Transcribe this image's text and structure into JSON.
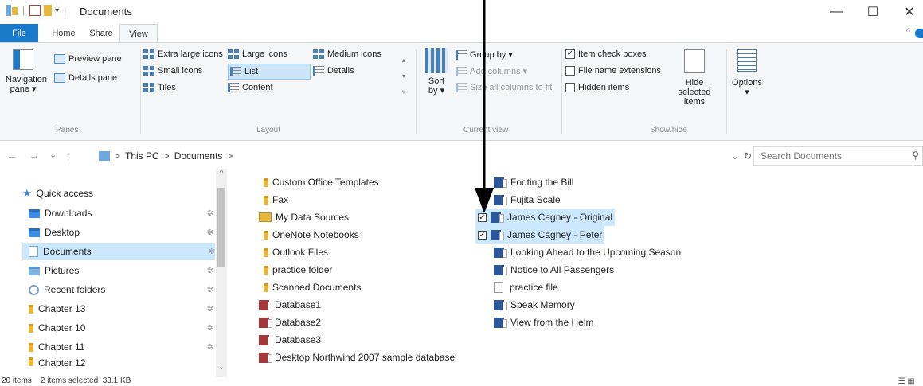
{
  "window": {
    "title": "Documents",
    "qat_dropdown": "▾",
    "minimize": "—",
    "maximize": "☐",
    "close": "✕"
  },
  "tabs": [
    {
      "label": "File"
    },
    {
      "label": "Home"
    },
    {
      "label": "Share"
    },
    {
      "label": "View"
    }
  ],
  "ribbon": {
    "panes": {
      "navigation_pane": "Navigation pane ▾",
      "preview_pane": "Preview pane",
      "details_pane": "Details pane",
      "group_label": "Panes"
    },
    "layout": {
      "extra_large_icons": "Extra large icons",
      "large_icons": "Large icons",
      "medium_icons": "Medium icons",
      "small_icons": "Small icons",
      "list": "List",
      "details": "Details",
      "tiles": "Tiles",
      "content": "Content",
      "group_label": "Layout",
      "selected": "List"
    },
    "current_view": {
      "sort_by": "Sort by ▾",
      "group_by": "Group by ▾",
      "add_columns": "Add columns ▾",
      "size_all_columns": "Size all columns to fit",
      "group_label": "Current view"
    },
    "show_hide": {
      "item_check_boxes": "Item check boxes",
      "item_check_boxes_checked": true,
      "file_name_extensions": "File name extensions",
      "file_name_extensions_checked": false,
      "hidden_items": "Hidden items",
      "hidden_items_checked": false,
      "hide_selected_items": "Hide selected items",
      "group_label": "Show/hide"
    },
    "options": {
      "label": "Options ▾"
    }
  },
  "address": {
    "back": "←",
    "forward": "→",
    "recent": "⌄",
    "up": "↑",
    "breadcrumb": [
      "This PC",
      "Documents"
    ],
    "sep": ">",
    "dropdown": "⌄",
    "refresh": "↻",
    "search_placeholder": "Search Documents",
    "search_glass": "⚲"
  },
  "nav": {
    "items": [
      {
        "label": "Quick access",
        "icon": "star-icon",
        "pinned": false,
        "selected": false
      },
      {
        "label": "Downloads",
        "icon": "downloads-icon",
        "pinned": true,
        "selected": false
      },
      {
        "label": "Desktop",
        "icon": "desktop-icon",
        "pinned": true,
        "selected": false
      },
      {
        "label": "Documents",
        "icon": "documents-icon",
        "pinned": true,
        "selected": true
      },
      {
        "label": "Pictures",
        "icon": "pictures-icon",
        "pinned": true,
        "selected": false
      },
      {
        "label": "Recent folders",
        "icon": "recent-icon",
        "pinned": true,
        "selected": false
      },
      {
        "label": "Chapter 13",
        "icon": "folder-icon",
        "pinned": true,
        "selected": false
      },
      {
        "label": "Chapter 10",
        "icon": "folder-icon",
        "pinned": true,
        "selected": false
      },
      {
        "label": "Chapter 11",
        "icon": "folder-icon",
        "pinned": true,
        "selected": false
      },
      {
        "label": "Chapter 12",
        "icon": "folder-icon",
        "pinned": true,
        "selected": false
      }
    ],
    "pin_glyph": "✲",
    "scroll_up": "^",
    "scroll_down": "⌄"
  },
  "files": {
    "col1": [
      {
        "name": "Custom Office Templates",
        "type": "folder"
      },
      {
        "name": "Fax",
        "type": "folder"
      },
      {
        "name": "My Data Sources",
        "type": "datasource"
      },
      {
        "name": "OneNote Notebooks",
        "type": "folder"
      },
      {
        "name": "Outlook Files",
        "type": "folder"
      },
      {
        "name": "practice folder",
        "type": "folder"
      },
      {
        "name": "Scanned Documents",
        "type": "folder"
      },
      {
        "name": "Database1",
        "type": "access"
      },
      {
        "name": "Database2",
        "type": "access"
      },
      {
        "name": "Database3",
        "type": "access"
      },
      {
        "name": "Desktop Northwind 2007 sample database",
        "type": "access"
      }
    ],
    "col2": [
      {
        "name": "Footing the Bill",
        "type": "word",
        "selected": false
      },
      {
        "name": "Fujita Scale",
        "type": "word",
        "selected": false
      },
      {
        "name": "James Cagney - Original",
        "type": "word",
        "selected": true
      },
      {
        "name": "James Cagney - Peter",
        "type": "word",
        "selected": true
      },
      {
        "name": "Looking Ahead to the Upcoming Season",
        "type": "word",
        "selected": false
      },
      {
        "name": "Notice to All Passengers",
        "type": "word",
        "selected": false
      },
      {
        "name": "practice file",
        "type": "text",
        "selected": false
      },
      {
        "name": "Speak Memory",
        "type": "word",
        "selected": false
      },
      {
        "name": "View from the Helm",
        "type": "word",
        "selected": false
      }
    ],
    "check_glyph": "✓"
  },
  "status": {
    "text": "20 items    2 items selected  33.1 KB",
    "view_glyphs": "☰ ▦"
  }
}
